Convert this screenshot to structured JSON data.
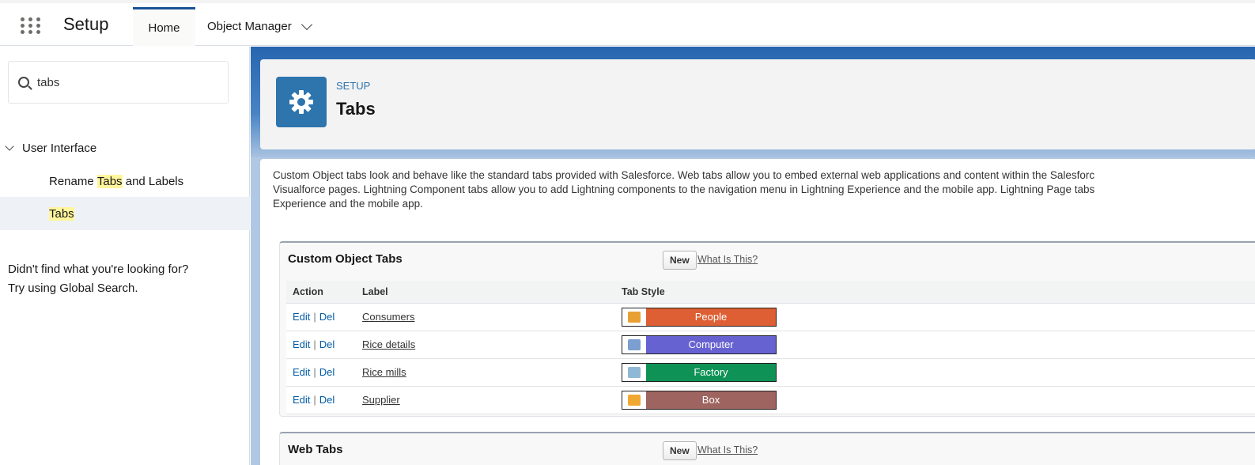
{
  "top": {
    "app_title": "Setup",
    "tabs": [
      {
        "label": "Home"
      },
      {
        "label": "Object Manager"
      }
    ]
  },
  "sidebar": {
    "search_value": "tabs",
    "group": "User Interface",
    "items": [
      {
        "pre": "Rename ",
        "hl": "Tabs",
        "post": " and Labels"
      },
      {
        "pre": "",
        "hl": "Tabs",
        "post": ""
      }
    ],
    "help_line1": "Didn't find what you're looking for?",
    "help_line2": "Try using Global Search."
  },
  "header": {
    "eyebrow": "SETUP",
    "title": "Tabs"
  },
  "description": {
    "line1": "Custom Object tabs look and behave like the standard tabs provided with Salesforce. Web tabs allow you to embed external web applications and content within the Salesforc",
    "line2": "Visualforce pages. Lightning Component tabs allow you to add Lightning components to the navigation menu in Lightning Experience and the mobile app. Lightning Page tabs",
    "line3": "Experience and the mobile app."
  },
  "custom_object_tabs": {
    "title": "Custom Object Tabs",
    "new_label": "New",
    "what_label": "What Is This?",
    "columns": [
      "Action",
      "Label",
      "Tab Style"
    ],
    "rows": [
      {
        "edit": "Edit",
        "del": "Del",
        "label": "Consumers",
        "style": "People",
        "color": "#dd5f33",
        "icon_color": "#e8a033"
      },
      {
        "edit": "Edit",
        "del": "Del",
        "label": "Rice details",
        "style": "Computer",
        "color": "#6762d1",
        "icon_color": "#7a9fd0"
      },
      {
        "edit": "Edit",
        "del": "Del",
        "label": "Rice mills",
        "style": "Factory",
        "color": "#0e9256",
        "icon_color": "#8fb8d6"
      },
      {
        "edit": "Edit",
        "del": "Del",
        "label": "Supplier",
        "style": "Box",
        "color": "#9e6460",
        "icon_color": "#f0a830"
      }
    ]
  },
  "web_tabs": {
    "title": "Web Tabs",
    "new_label": "New",
    "what_label": "What Is This?"
  }
}
